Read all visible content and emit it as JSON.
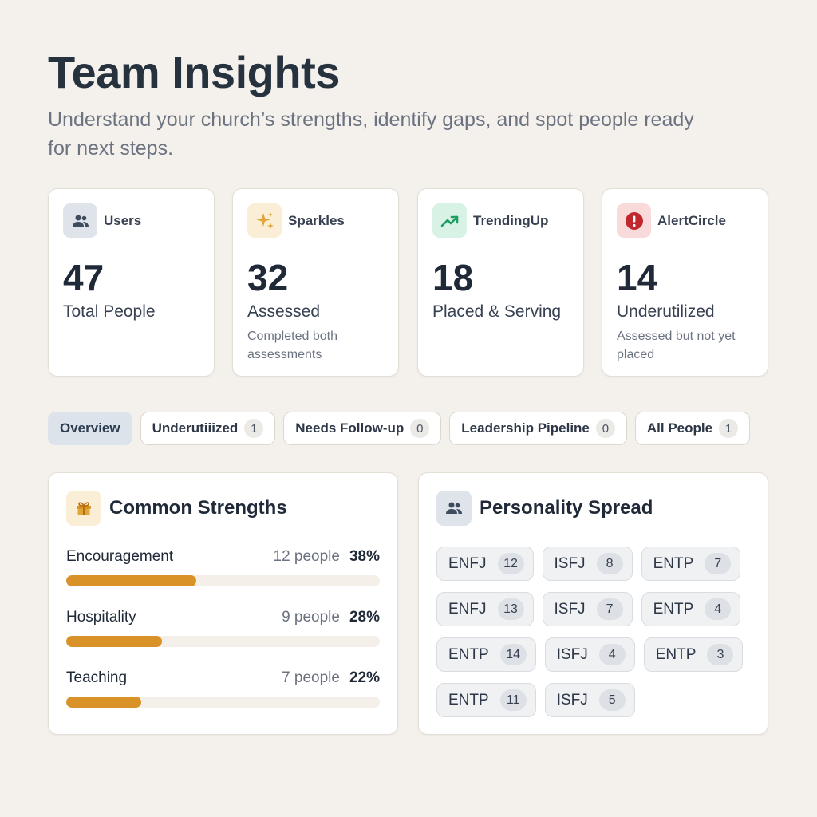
{
  "header": {
    "title": "Team Insights",
    "subtitle": "Understand your church’s strengths, identify gaps, and spot people ready for next steps."
  },
  "stats": [
    {
      "icon": "users-icon",
      "icon_label": "Users",
      "value": "47",
      "label": "Total People",
      "description": "",
      "icon_color": "#3f4b5e",
      "icon_bg": "#dfe4ea"
    },
    {
      "icon": "sparkles-icon",
      "icon_label": "Sparkles",
      "value": "32",
      "label": "Assessed",
      "description": "Completed both assessments",
      "icon_color": "#d89228",
      "icon_bg": "#fbeed6"
    },
    {
      "icon": "trending-up-icon",
      "icon_label": "TrendingUp",
      "value": "18",
      "label": "Placed & Serving",
      "description": "",
      "icon_color": "#1f9d62",
      "icon_bg": "#d9f2e6"
    },
    {
      "icon": "alert-circle-icon",
      "icon_label": "AlertCircle",
      "value": "14",
      "label": "Underutilized",
      "description": "Assessed but not yet placed",
      "icon_color": "#c0282e",
      "icon_bg": "#f8dada"
    }
  ],
  "tabs": [
    {
      "label": "Overview",
      "count": null,
      "active": true
    },
    {
      "label": "Underutiiized",
      "count": "1",
      "active": false
    },
    {
      "label": "Needs Follow-up",
      "count": "0",
      "active": false
    },
    {
      "label": "Leadership Pipeline",
      "count": "0",
      "active": false
    },
    {
      "label": "All People",
      "count": "1",
      "active": false
    }
  ],
  "strengths_panel": {
    "title": "Common Strengths",
    "icon": "gift-icon",
    "items": [
      {
        "name": "Encouragement",
        "count": "12 people",
        "percent": "38%",
        "fill": 0.38
      },
      {
        "name": "Hospitality",
        "count": "9 people",
        "percent": "28%",
        "fill": 0.28
      },
      {
        "name": "Teaching",
        "count": "7 people",
        "percent": "22%",
        "fill": 0.22
      }
    ]
  },
  "personality_panel": {
    "title": "Personality Spread",
    "icon": "users-icon",
    "rows": [
      [
        {
          "type": "ENFJ",
          "count": "12"
        },
        {
          "type": "ISFJ",
          "count": "8"
        },
        {
          "type": "ENTP",
          "count": "7"
        }
      ],
      [
        {
          "type": "ENFJ",
          "count": "13"
        },
        {
          "type": "ISFJ",
          "count": "7"
        },
        {
          "type": "ENTP",
          "count": "4"
        }
      ],
      [
        {
          "type": "ENTP",
          "count": "14"
        },
        {
          "type": "ISFJ",
          "count": "4"
        },
        {
          "type": "ENTP",
          "count": "3"
        }
      ],
      [
        {
          "type": "ENTP",
          "count": "11"
        },
        {
          "type": "ISFJ",
          "count": "5"
        }
      ]
    ]
  },
  "colors": {
    "accent": "#d89228",
    "background": "#f4f1ec"
  }
}
